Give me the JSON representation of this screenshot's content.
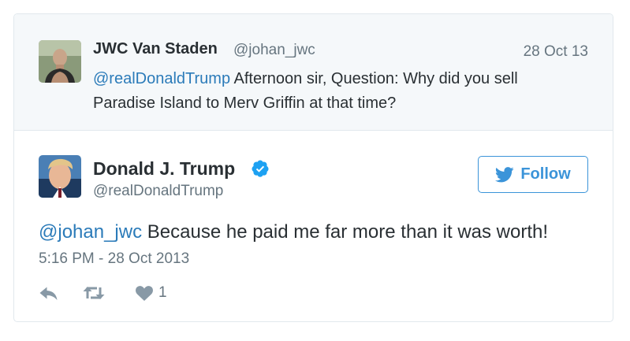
{
  "parent_tweet": {
    "name": "JWC Van Staden",
    "handle": "@johan_jwc",
    "date": "28 Oct 13",
    "mention": "@realDonaldTrump",
    "text": " Afternoon sir, Question: Why did you sell Paradise Island to Merv Griffin at that time?"
  },
  "main_tweet": {
    "name": "Donald J. Trump",
    "handle": "@realDonaldTrump",
    "follow_label": "Follow",
    "mention": "@johan_jwc",
    "text": " Because he paid me far more than it was worth!",
    "timestamp": "5:16 PM - 28 Oct 2013",
    "like_count": "1"
  },
  "colors": {
    "link": "#2b7bb9",
    "follow": "#3b94d9",
    "verified": "#1da1f2",
    "muted": "#66757f",
    "icons": "#8899a6"
  },
  "icons": [
    "reply-icon",
    "retweet-icon",
    "heart-icon",
    "twitter-bird-icon",
    "verified-badge-icon"
  ]
}
